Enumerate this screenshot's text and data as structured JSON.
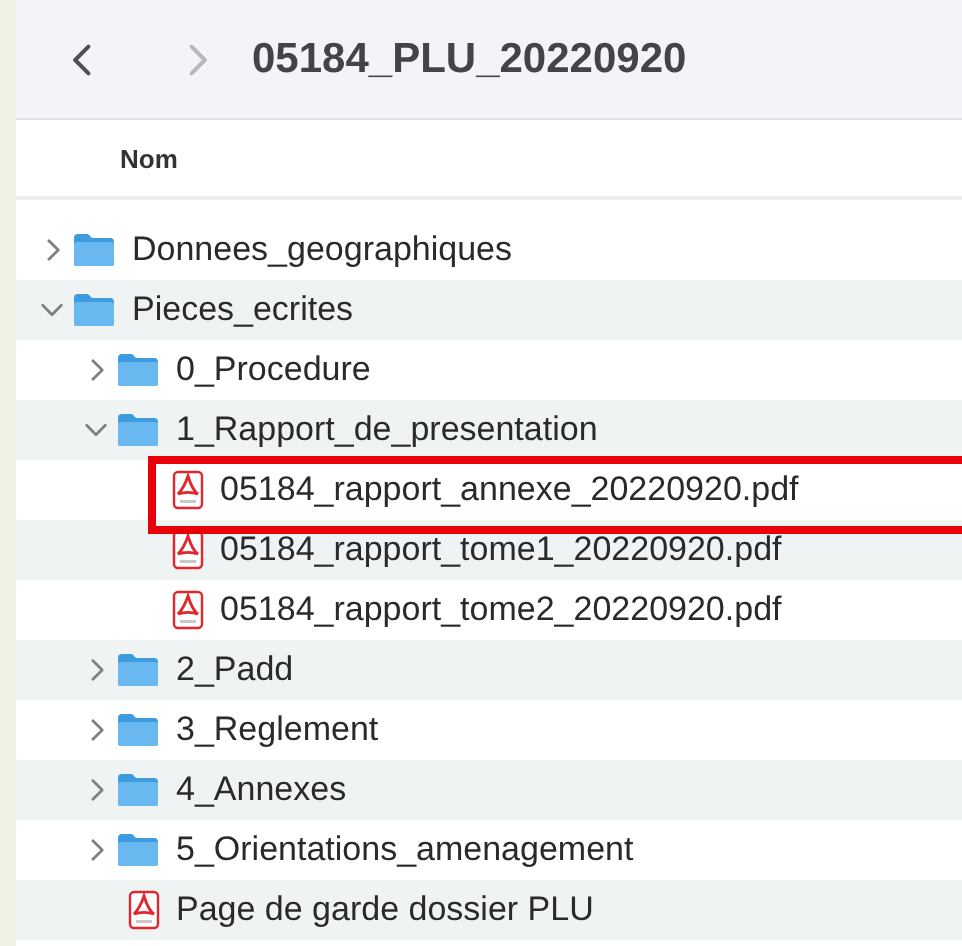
{
  "navigation": [
    {
      "kind": "back",
      "disabled": false
    },
    {
      "kind": "forward",
      "disabled": true
    }
  ],
  "window": {
    "title": "05184_PLU_20220920"
  },
  "column_header": "Nom",
  "items": [
    {
      "name": "Donnees_geographiques",
      "kind": "folder",
      "expanded": false
    },
    {
      "name": "Pieces_ecrites",
      "kind": "folder",
      "expanded": true,
      "children": [
        {
          "name": "0_Procedure",
          "kind": "folder",
          "expanded": false
        },
        {
          "name": "1_Rapport_de_presentation",
          "kind": "folder",
          "expanded": true,
          "children": [
            {
              "name": "05184_rapport_annexe_20220920.pdf",
              "kind": "pdf",
              "highlighted": true
            },
            {
              "name": "05184_rapport_tome1_20220920.pdf",
              "kind": "pdf",
              "highlighted": false
            },
            {
              "name": "05184_rapport_tome2_20220920.pdf",
              "kind": "pdf",
              "highlighted": false
            }
          ]
        },
        {
          "name": "2_Padd",
          "kind": "folder",
          "expanded": false
        },
        {
          "name": "3_Reglement",
          "kind": "folder",
          "expanded": false
        },
        {
          "name": "4_Annexes",
          "kind": "folder",
          "expanded": false
        },
        {
          "name": "5_Orientations_amenagement",
          "kind": "folder",
          "expanded": false
        },
        {
          "name": "Page de garde dossier PLU",
          "kind": "pdf",
          "highlighted": false
        }
      ]
    }
  ]
}
